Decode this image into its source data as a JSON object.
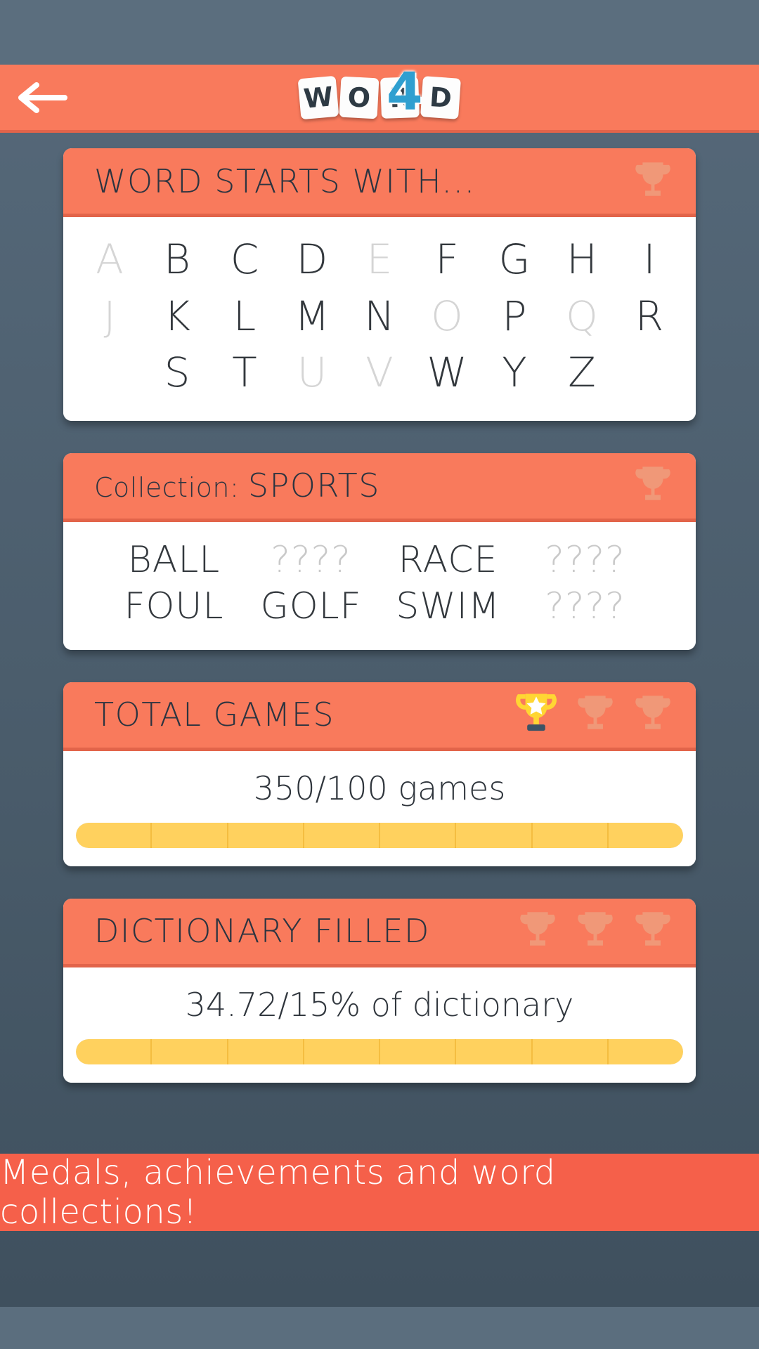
{
  "header": {
    "back_icon": "back-arrow-icon",
    "logo_tiles": [
      "W",
      "O",
      "R",
      "D"
    ],
    "logo_overlay": "4",
    "logo_overlay_color": "#2f9fd0",
    "bg_color": "#f97a5c"
  },
  "cards": [
    {
      "id": "word-starts-with",
      "title": "WORD STARTS WITH...",
      "trophies": [
        {
          "state": "locked",
          "color": "#f09878"
        }
      ],
      "alphabet_rows": [
        [
          {
            "letter": "A",
            "found": false
          },
          {
            "letter": "B",
            "found": true
          },
          {
            "letter": "C",
            "found": true
          },
          {
            "letter": "D",
            "found": true
          },
          {
            "letter": "E",
            "found": false
          },
          {
            "letter": "F",
            "found": true
          },
          {
            "letter": "G",
            "found": true
          },
          {
            "letter": "H",
            "found": true
          },
          {
            "letter": "I",
            "found": true
          }
        ],
        [
          {
            "letter": "J",
            "found": false
          },
          {
            "letter": "K",
            "found": true
          },
          {
            "letter": "L",
            "found": true
          },
          {
            "letter": "M",
            "found": true
          },
          {
            "letter": "N",
            "found": true
          },
          {
            "letter": "O",
            "found": false
          },
          {
            "letter": "P",
            "found": true
          },
          {
            "letter": "Q",
            "found": false
          },
          {
            "letter": "R",
            "found": true
          }
        ],
        [
          {
            "letter": "S",
            "found": true
          },
          {
            "letter": "T",
            "found": true
          },
          {
            "letter": "U",
            "found": false
          },
          {
            "letter": "V",
            "found": false
          },
          {
            "letter": "W",
            "found": true
          },
          {
            "letter": "Y",
            "found": true
          },
          {
            "letter": "Z",
            "found": true
          }
        ]
      ]
    },
    {
      "id": "collection-sports",
      "title_prefix": "Collection: ",
      "title_value": "SPORTS",
      "trophies": [
        {
          "state": "locked",
          "color": "#f09878"
        }
      ],
      "word_rows": [
        [
          {
            "word": "BALL",
            "found": true
          },
          {
            "word": "????",
            "found": false
          },
          {
            "word": "RACE",
            "found": true
          },
          {
            "word": "????",
            "found": false
          }
        ],
        [
          {
            "word": "FOUL",
            "found": true
          },
          {
            "word": "GOLF",
            "found": true
          },
          {
            "word": "SWIM",
            "found": true
          },
          {
            "word": "????",
            "found": false
          }
        ]
      ]
    },
    {
      "id": "total-games",
      "title": "TOTAL GAMES",
      "trophies": [
        {
          "state": "earned",
          "color": "#ffd633"
        },
        {
          "state": "locked",
          "color": "#f09878"
        },
        {
          "state": "locked",
          "color": "#f09878"
        }
      ],
      "progress_label": "350/100 games",
      "progress_percent": 100,
      "progress_segments": 8,
      "progress_color": "#ffd15e"
    },
    {
      "id": "dictionary-filled",
      "title": "DICTIONARY FILLED",
      "trophies": [
        {
          "state": "locked",
          "color": "#f09878"
        },
        {
          "state": "locked",
          "color": "#f09878"
        },
        {
          "state": "locked",
          "color": "#f09878"
        }
      ],
      "progress_label": "34.72/15% of dictionary",
      "progress_percent": 100,
      "progress_segments": 8,
      "progress_color": "#ffd15e"
    }
  ],
  "banner": {
    "text": "Medals, achievements and word collections!",
    "bg_color": "#f5604a"
  }
}
